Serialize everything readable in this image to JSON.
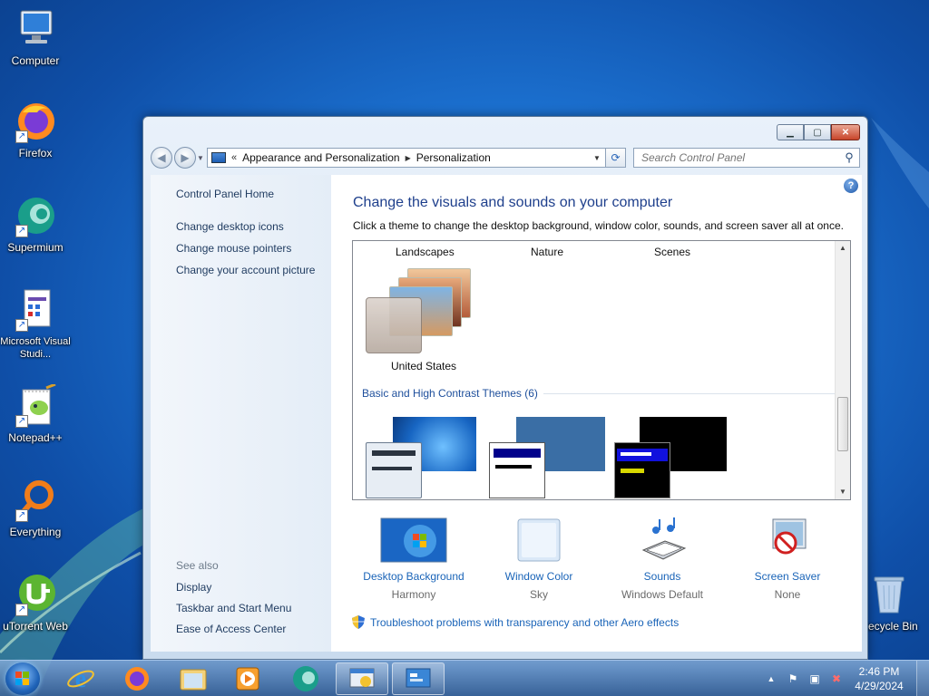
{
  "desktop": {
    "icons": [
      {
        "label": "Computer",
        "icon": "computer-icon"
      },
      {
        "label": "Firefox",
        "icon": "firefox-icon"
      },
      {
        "label": "Supermium",
        "icon": "supermium-icon"
      },
      {
        "label": "Microsoft Visual Studi...",
        "icon": "visual-studio-icon"
      },
      {
        "label": "Notepad++",
        "icon": "notepadpp-icon"
      },
      {
        "label": "Everything",
        "icon": "everything-icon"
      },
      {
        "label": "uTorrent Web",
        "icon": "utorrent-icon"
      },
      {
        "label": "Recycle Bin",
        "icon": "recycle-bin-icon"
      }
    ]
  },
  "window": {
    "caption": {
      "minimize": "▁",
      "maximize": "▢",
      "close": "✕"
    },
    "address": {
      "overflow": "«",
      "crumbs": [
        "Appearance and Personalization",
        "Personalization"
      ],
      "separator": "▶",
      "dropdown": "▼"
    },
    "refresh": "⟳",
    "search": {
      "placeholder": "Search Control Panel",
      "icon": "magnifier-icon"
    },
    "sidebar": {
      "home": "Control Panel Home",
      "links": [
        "Change desktop icons",
        "Change mouse pointers",
        "Change your account picture"
      ],
      "see_also_header": "See also",
      "see_also": [
        "Display",
        "Taskbar and Start Menu",
        "Ease of Access Center"
      ]
    },
    "main": {
      "help": "?",
      "title": "Change the visuals and sounds on your computer",
      "description": "Click a theme to change the desktop background, window color, sounds, and screen saver all at once.",
      "theme_columns": [
        "Landscapes",
        "Nature",
        "Scenes"
      ],
      "selected_theme": "United States",
      "basic_group": "Basic and High Contrast Themes (6)",
      "scroll_up": "▲",
      "scroll_down": "▼",
      "shortcuts": [
        {
          "title": "Desktop Background",
          "value": "Harmony",
          "icon": "desktop-background-icon"
        },
        {
          "title": "Window Color",
          "value": "Sky",
          "icon": "window-color-icon"
        },
        {
          "title": "Sounds",
          "value": "Windows Default",
          "icon": "sounds-icon"
        },
        {
          "title": "Screen Saver",
          "value": "None",
          "icon": "screen-saver-icon"
        }
      ],
      "troubleshoot": "Troubleshoot problems with transparency and other Aero effects"
    }
  },
  "taskbar": {
    "items": [
      "start-button",
      "internet-explorer",
      "firefox",
      "file-explorer",
      "media-player",
      "supermium",
      "personalization-window",
      "control-panel"
    ],
    "tray": {
      "arrow": "▲",
      "time": "2:46 PM",
      "date": "4/29/2024"
    }
  }
}
